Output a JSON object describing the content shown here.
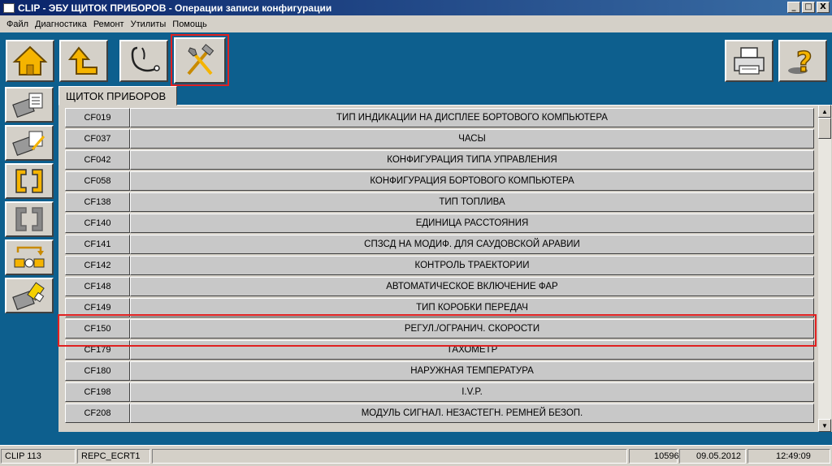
{
  "window": {
    "title": "CLIP - ЭБУ ЩИТОК ПРИБОРОВ - Операции записи конфигурации",
    "controls": [
      "_",
      "□",
      "X"
    ]
  },
  "menu": [
    "Файл",
    "Диагностика",
    "Ремонт",
    "Утилиты",
    "Помощь"
  ],
  "toolbar": {
    "left": [
      "home-icon",
      "back-up-icon",
      "stethoscope-icon",
      "tools-icon"
    ],
    "right": [
      "printer-icon",
      "help-icon"
    ],
    "highlighted": "tools-icon"
  },
  "side_buttons": [
    "ecu-read-icon",
    "ecu-write-icon",
    "connector-icon",
    "connector-disabled-icon",
    "transfer-icon",
    "eraser-icon"
  ],
  "tab": {
    "label": "ЩИТОК ПРИБОРОВ"
  },
  "rows": [
    {
      "code": "CF019",
      "desc": "ТИП ИНДИКАЦИИ НА ДИСПЛЕЕ БОРТОВОГО КОМПЬЮТЕРА"
    },
    {
      "code": "CF037",
      "desc": "ЧАСЫ"
    },
    {
      "code": "CF042",
      "desc": "КОНФИГУРАЦИЯ ТИПА УПРАВЛЕНИЯ"
    },
    {
      "code": "CF058",
      "desc": "КОНФИГУРАЦИЯ БОРТОВОГО КОМПЬЮТЕРА"
    },
    {
      "code": "CF138",
      "desc": "ТИП ТОПЛИВА"
    },
    {
      "code": "CF140",
      "desc": "ЕДИНИЦА РАССТОЯНИЯ"
    },
    {
      "code": "CF141",
      "desc": "СПЗСД НА МОДИФ. ДЛЯ САУДОВСКОЙ АРАВИИ"
    },
    {
      "code": "CF142",
      "desc": "КОНТРОЛЬ ТРАЕКТОРИИ"
    },
    {
      "code": "CF148",
      "desc": "АВТОМАТИЧЕСКОЕ ВКЛЮЧЕНИЕ ФАР"
    },
    {
      "code": "CF149",
      "desc": "ТИП КОРОБКИ ПЕРЕДАЧ"
    },
    {
      "code": "CF150",
      "desc": "РЕГУЛ./ОГРАНИЧ. СКОРОСТИ"
    },
    {
      "code": "CF179",
      "desc": "ТАХОМЕТР"
    },
    {
      "code": "CF180",
      "desc": "НАРУЖНАЯ ТЕМПЕРАТУРА"
    },
    {
      "code": "CF198",
      "desc": "I.V.P."
    },
    {
      "code": "CF208",
      "desc": "МОДУЛЬ СИГНАЛ. НЕЗАСТЕГН. РЕМНЕЙ БЕЗОП."
    }
  ],
  "highlighted_row": "CF150",
  "status": {
    "clip": "CLIP 113",
    "screen": "REPC_ECRT1",
    "code": "10596",
    "date": "09.05.2012",
    "time": "12:49:09"
  },
  "colors": {
    "background": "#0d5f8e",
    "highlight": "#e02020",
    "title_start": "#0a246a"
  }
}
